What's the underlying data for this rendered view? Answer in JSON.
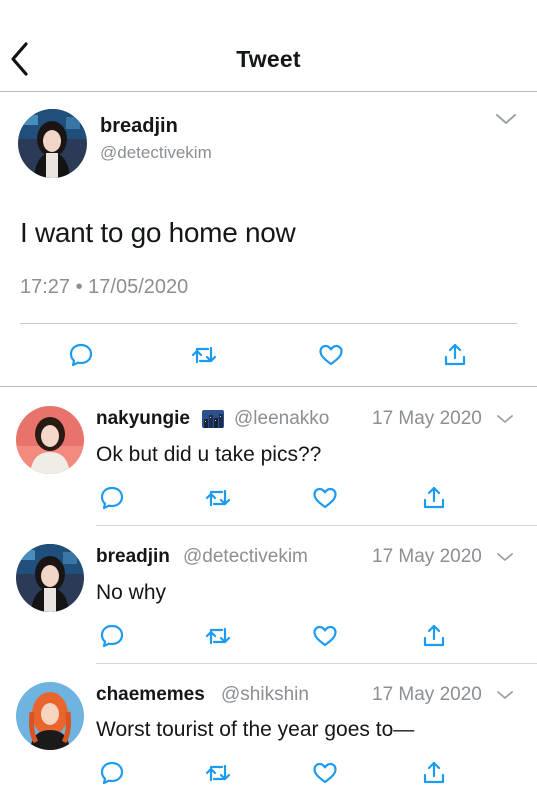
{
  "header": {
    "title": "Tweet",
    "back_icon": "chevron-left-icon"
  },
  "main_tweet": {
    "name": "breadjin",
    "handle": "@detectivekim",
    "text": "I want to go home now",
    "timestamp": "17:27 • 17/05/2020",
    "actions": [
      "reply-icon",
      "retweet-icon",
      "like-icon",
      "share-icon"
    ]
  },
  "replies": [
    {
      "name": "nakyungie",
      "handle": "@leenakko",
      "date": "17 May 2020",
      "text": "Ok but did u take pics??",
      "name_emoji": "night-city-emoji"
    },
    {
      "name": "breadjin",
      "handle": "@detectivekim",
      "date": "17 May 2020",
      "text": "No why"
    },
    {
      "name": "chaememes",
      "handle": "@shikshin",
      "date": "17 May 2020",
      "text": "Worst tourist of the year goes to—"
    }
  ],
  "colors": {
    "text": "#14171a",
    "secondary": "#8a8f94",
    "icon": "#1d9bf0",
    "divider": "#b8b8b8"
  }
}
